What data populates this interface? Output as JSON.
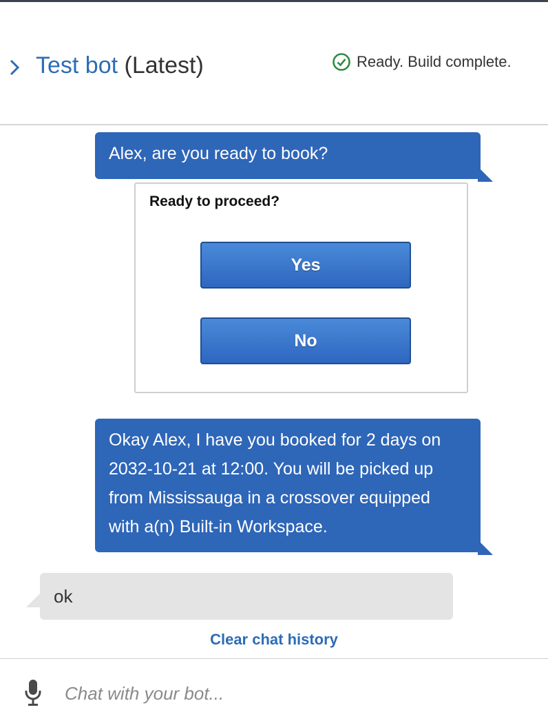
{
  "header": {
    "title_link": "Test bot",
    "version": "(Latest)",
    "status_text": "Ready. Build complete."
  },
  "messages": [
    {
      "from": "bot",
      "text": "Alex, are you ready to book?"
    },
    {
      "from": "bot",
      "lines": [
        "Okay Alex, I have you booked for 2 days on",
        "2032-10-21 at 12:00. You will be picked up",
        "from Mississauga in a crossover equipped",
        "with a(n) Built-in Workspace."
      ]
    },
    {
      "from": "user",
      "text": "ok"
    }
  ],
  "response_card": {
    "title": "Ready to proceed?",
    "buttons": [
      "Yes",
      "No"
    ]
  },
  "clear_history_label": "Clear chat history",
  "input": {
    "placeholder": "Chat with your bot...",
    "value": ""
  },
  "icons": {
    "expand": "chevron-right-icon",
    "status": "check-circle-icon",
    "mic": "microphone-icon"
  },
  "colors": {
    "accent": "#2d6cb5",
    "bot_bubble": "#2e66b8",
    "user_bubble": "#e4e4e4",
    "status_ok": "#2e8b3e"
  }
}
